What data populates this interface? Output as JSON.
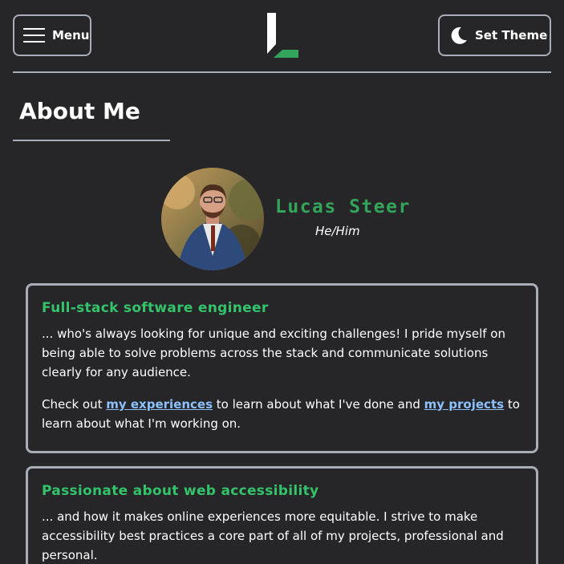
{
  "header": {
    "menu_label": "Menu",
    "theme_label": "Set Theme",
    "icons": {
      "menu": "hamburger-icon",
      "theme": "moon-icon",
      "logo": "site-logo"
    }
  },
  "about": {
    "title": "About Me"
  },
  "profile": {
    "name": "Lucas Steer",
    "pronouns": "He/Him"
  },
  "cards": [
    {
      "title": "Full-stack software engineer",
      "p1": "... who's always looking for unique and exciting challenges! I pride myself on being able to solve problems across the stack and communicate solutions clearly for any audience.",
      "p2_before": "Check out ",
      "p2_link1": "my experiences",
      "p2_middle": " to learn about what I've done and ",
      "p2_link2": "my projects",
      "p2_after": " to learn about what I'm working on."
    },
    {
      "title": "Passionate about web accessibility",
      "p1": "... and how it makes online experiences more equitable. I strive to make accessibility best practices a core part of all of my projects, professional and personal."
    }
  ],
  "colors": {
    "background": "#262628",
    "border": "#a9adb8",
    "accent_green": "#33a55a",
    "link": "#8cc0ff"
  }
}
